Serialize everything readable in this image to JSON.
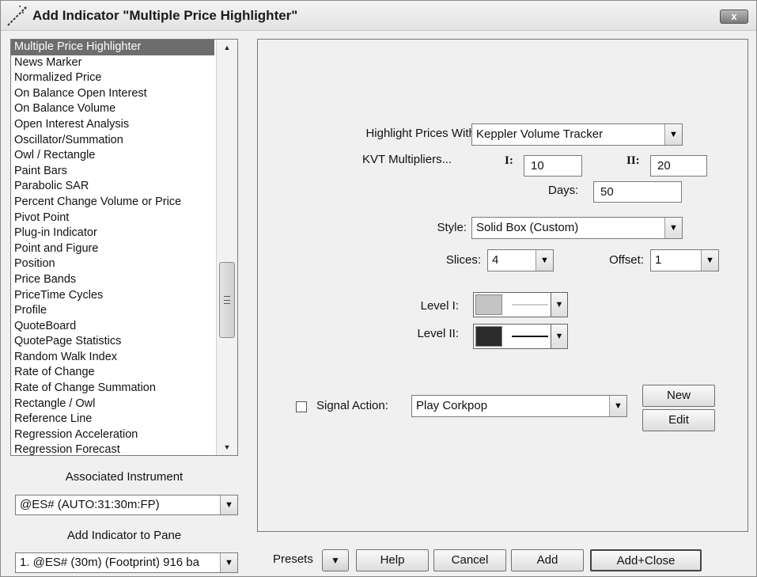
{
  "window": {
    "title": "Add Indicator \"Multiple Price Highlighter\"",
    "close_icon": "close-icon",
    "close_label": "x"
  },
  "indicator_list": {
    "items": [
      "Multiple Price Highlighter",
      "News Marker",
      "Normalized Price",
      "On Balance Open Interest",
      "On Balance Volume",
      "Open Interest Analysis",
      "Oscillator/Summation",
      "Owl / Rectangle",
      "Paint Bars",
      "Parabolic SAR",
      "Percent Change Volume or Price",
      "Pivot Point",
      "Plug-in Indicator",
      "Point and Figure",
      "Position",
      "Price Bands",
      "PriceTime Cycles",
      "Profile",
      "QuoteBoard",
      "QuotePage Statistics",
      "Random Walk Index",
      "Rate of Change",
      "Rate of Change Summation",
      "Rectangle / Owl",
      "Reference Line",
      "Regression Acceleration",
      "Regression Forecast"
    ],
    "selected": "Multiple Price Highlighter"
  },
  "instrument": {
    "label": "Associated Instrument",
    "value": "@ES# (AUTO:31:30m:FP)"
  },
  "pane": {
    "label": "Add Indicator to Pane",
    "value": "1. @ES# (30m) (Footprint) 916 ba"
  },
  "settings": {
    "highlight_label": "Highlight Prices With:",
    "highlight_value": "Keppler Volume Tracker",
    "kvt_label": "KVT Multipliers...",
    "mult_i_label": "I:",
    "mult_i_value": "10",
    "mult_ii_label": "II:",
    "mult_ii_value": "20",
    "days_label": "Days:",
    "days_value": "50",
    "style_label": "Style:",
    "style_value": "Solid Box (Custom)",
    "slices_label": "Slices:",
    "slices_value": "4",
    "offset_label": "Offset:",
    "offset_value": "1",
    "level1_label": "Level I:",
    "level1_color": "#c4c4c4",
    "level2_label": "Level II:",
    "level2_color": "#2b2b2b",
    "signal_checked": false,
    "signal_label": "Signal Action:",
    "signal_value": "Play Corkpop",
    "new_label": "New",
    "edit_label": "Edit"
  },
  "footer": {
    "presets_label": "Presets",
    "help_label": "Help",
    "cancel_label": "Cancel",
    "add_label": "Add",
    "add_close_label": "Add+Close"
  }
}
